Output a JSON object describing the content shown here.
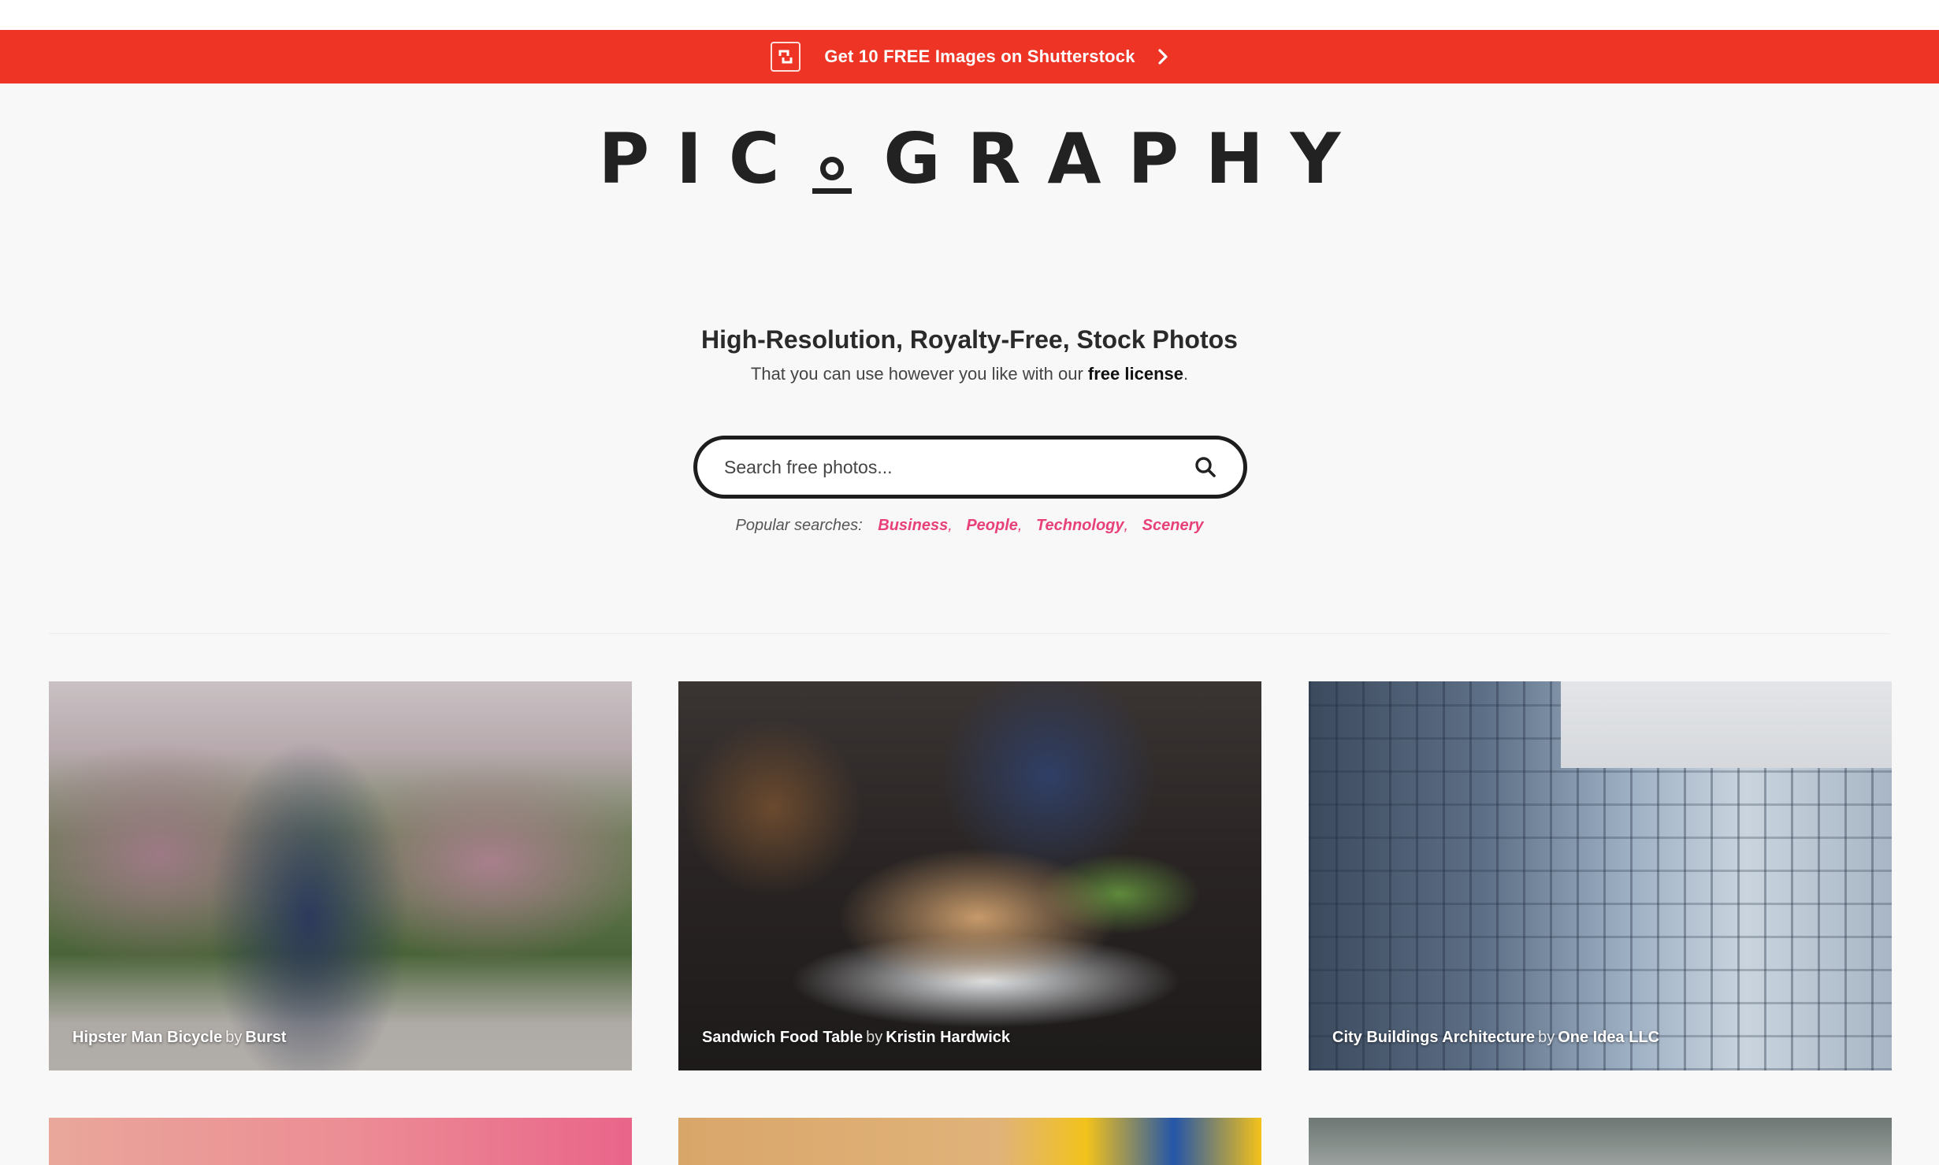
{
  "promo_banner": {
    "text": "Get 10 FREE Images on Shutterstock",
    "bg_color": "#ee3424",
    "icon": "shutterstock-logo-icon",
    "chevron_icon": "chevron-right-icon"
  },
  "brand": {
    "logo_left": "PIC",
    "logo_right": "GRAPHY",
    "logo_o_icon": "camera-o-mark-icon"
  },
  "hero": {
    "tagline": "High-Resolution, Royalty-Free, Stock Photos",
    "subline_prefix": "That you can use however you like with our",
    "subline_link": "free license",
    "subline_suffix": "."
  },
  "search": {
    "placeholder": "Search free photos...",
    "icon": "search-icon"
  },
  "popular": {
    "label": "Popular searches:",
    "terms": [
      "Business",
      "People",
      "Technology",
      "Scenery"
    ],
    "link_color": "#e8407a"
  },
  "photos": [
    {
      "title": "Hipster Man Bicycle",
      "by": "by",
      "author": "Burst"
    },
    {
      "title": "Sandwich Food Table",
      "by": "by",
      "author": "Kristin Hardwick"
    },
    {
      "title": "City Buildings Architecture",
      "by": "by",
      "author": "One Idea LLC"
    }
  ]
}
